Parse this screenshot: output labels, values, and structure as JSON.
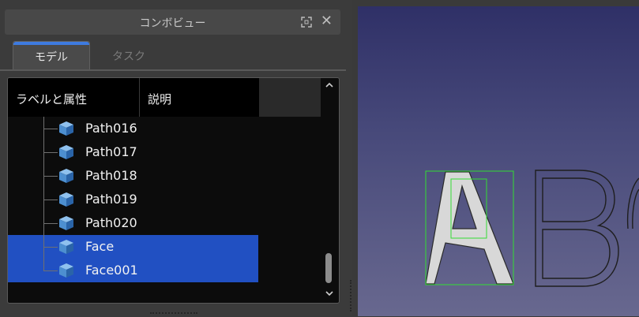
{
  "combo_view": {
    "title": "コンボビュー",
    "float_icon": "float-window-icon",
    "close_symbol": "✕"
  },
  "tabs": [
    {
      "label": "モデル",
      "active": true
    },
    {
      "label": "タスク",
      "active": false
    }
  ],
  "tree": {
    "columns": {
      "label": "ラベルと属性",
      "description": "説明"
    },
    "items": [
      {
        "label": "Path016",
        "selected": false,
        "icon": "part-cube-icon"
      },
      {
        "label": "Path017",
        "selected": false,
        "icon": "part-cube-icon"
      },
      {
        "label": "Path018",
        "selected": false,
        "icon": "part-cube-icon"
      },
      {
        "label": "Path019",
        "selected": false,
        "icon": "part-cube-icon"
      },
      {
        "label": "Path020",
        "selected": false,
        "icon": "part-cube-icon"
      },
      {
        "label": "Face",
        "selected": true,
        "icon": "part-cube-icon"
      },
      {
        "label": "Face001",
        "selected": true,
        "icon": "part-cube-icon"
      }
    ]
  },
  "colors": {
    "selection": "#2150c2",
    "active_tab_accent": "#3e7be0",
    "bounding_box": "#33dd33",
    "glyph_fill": "#d8d8d8"
  }
}
